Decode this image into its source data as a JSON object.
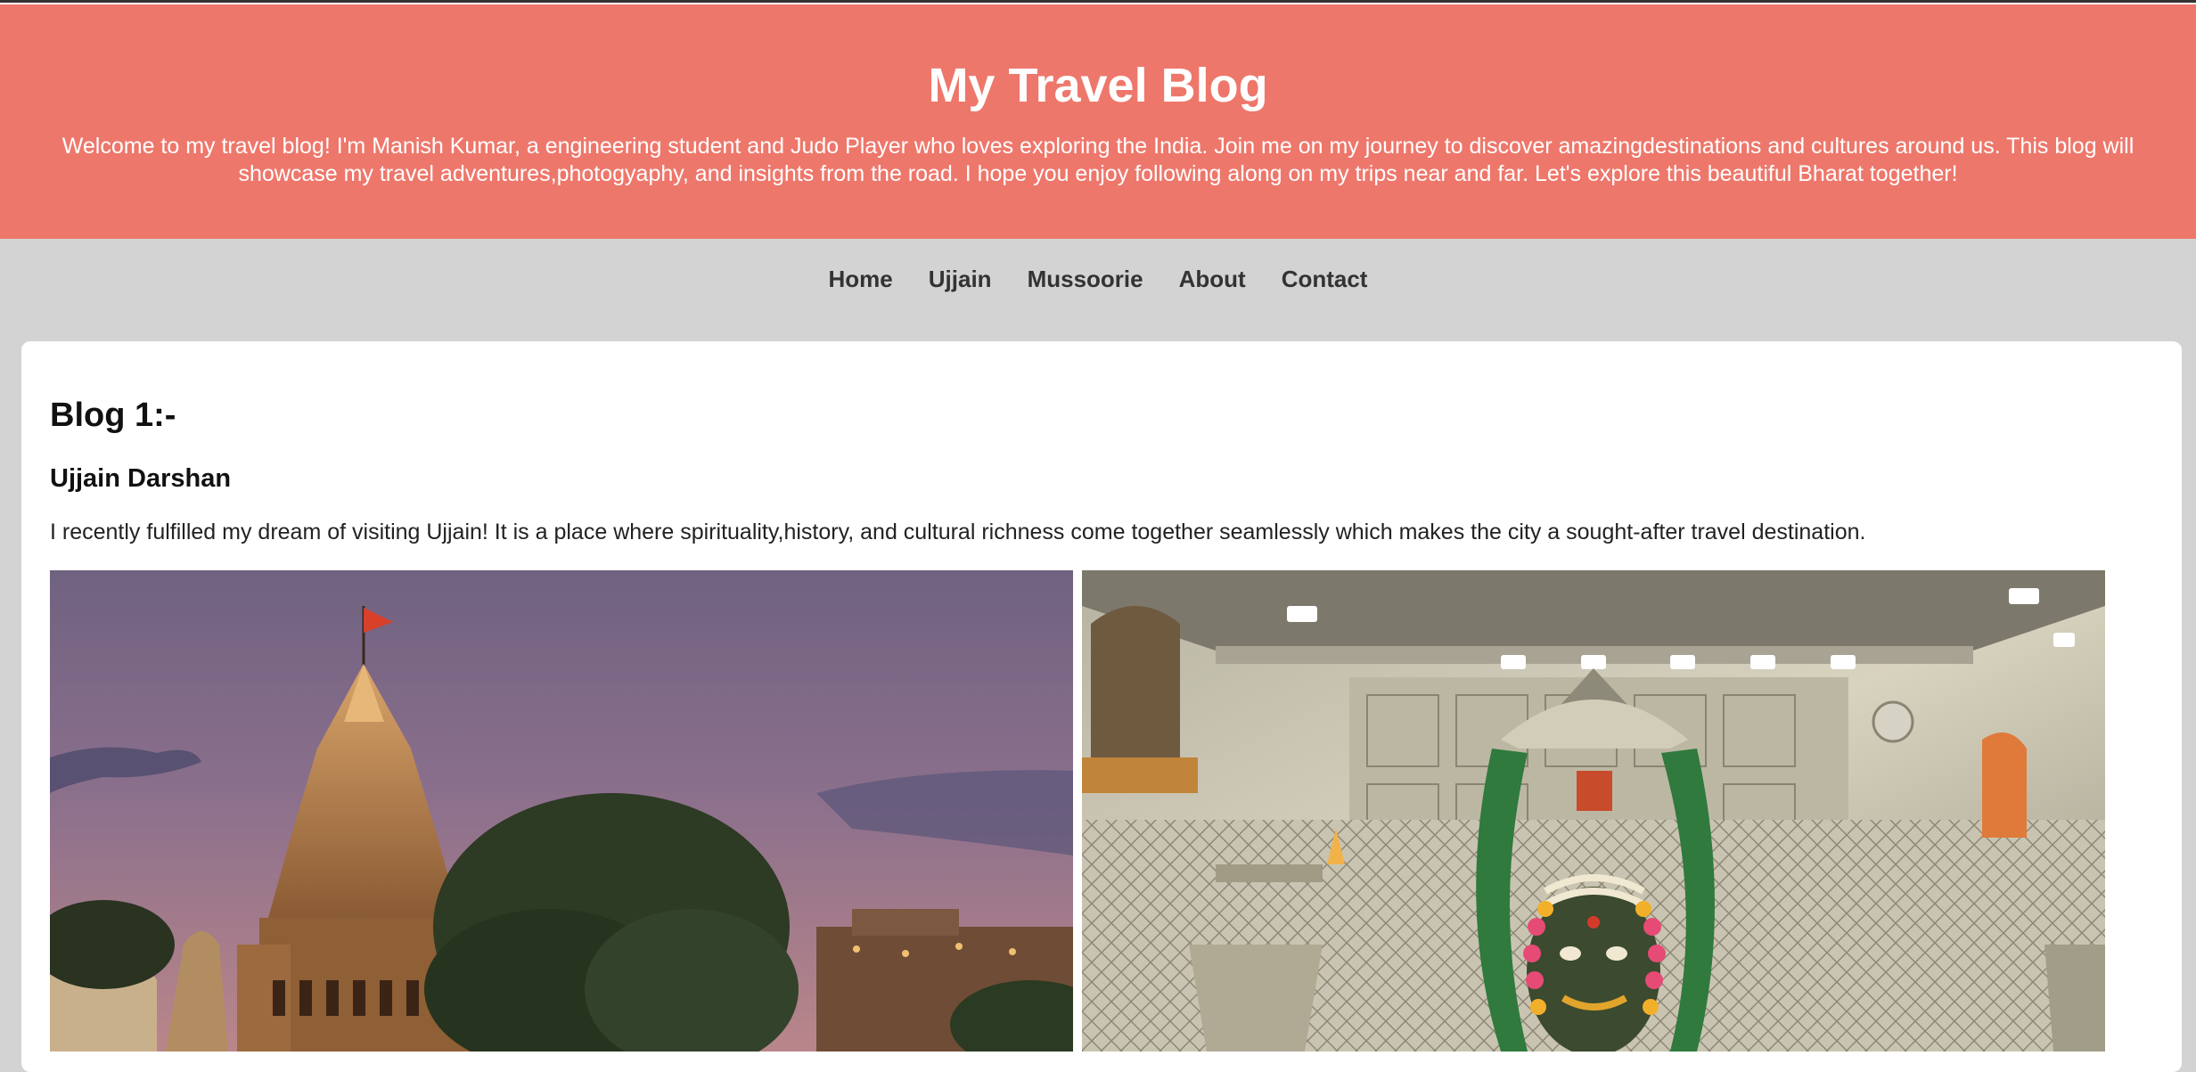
{
  "header": {
    "title": "My Travel Blog",
    "intro": "Welcome to my travel blog! I'm Manish Kumar, a engineering student and Judo Player who loves exploring the India. Join me on my journey to discover amazingdestinations and cultures around us. This blog will showcase my travel adventures,photogyaphy, and insights from the road. I hope you enjoy following along on my trips near and far. Let's explore this beautiful Bharat together!"
  },
  "nav": {
    "items": [
      {
        "label": "Home"
      },
      {
        "label": "Ujjain"
      },
      {
        "label": "Mussoorie"
      },
      {
        "label": "About"
      },
      {
        "label": "Contact"
      }
    ]
  },
  "post": {
    "heading": "Blog 1:-",
    "subheading": "Ujjain Darshan",
    "body": "I recently fulfilled my dream of visiting Ujjain! It is a place where spirituality,history, and cultural richness come together seamlessly which makes the city a sought-after travel destination."
  },
  "colors": {
    "header_bg": "#ee776b",
    "page_bg": "#d3d3d3",
    "card_bg": "#ffffff"
  }
}
